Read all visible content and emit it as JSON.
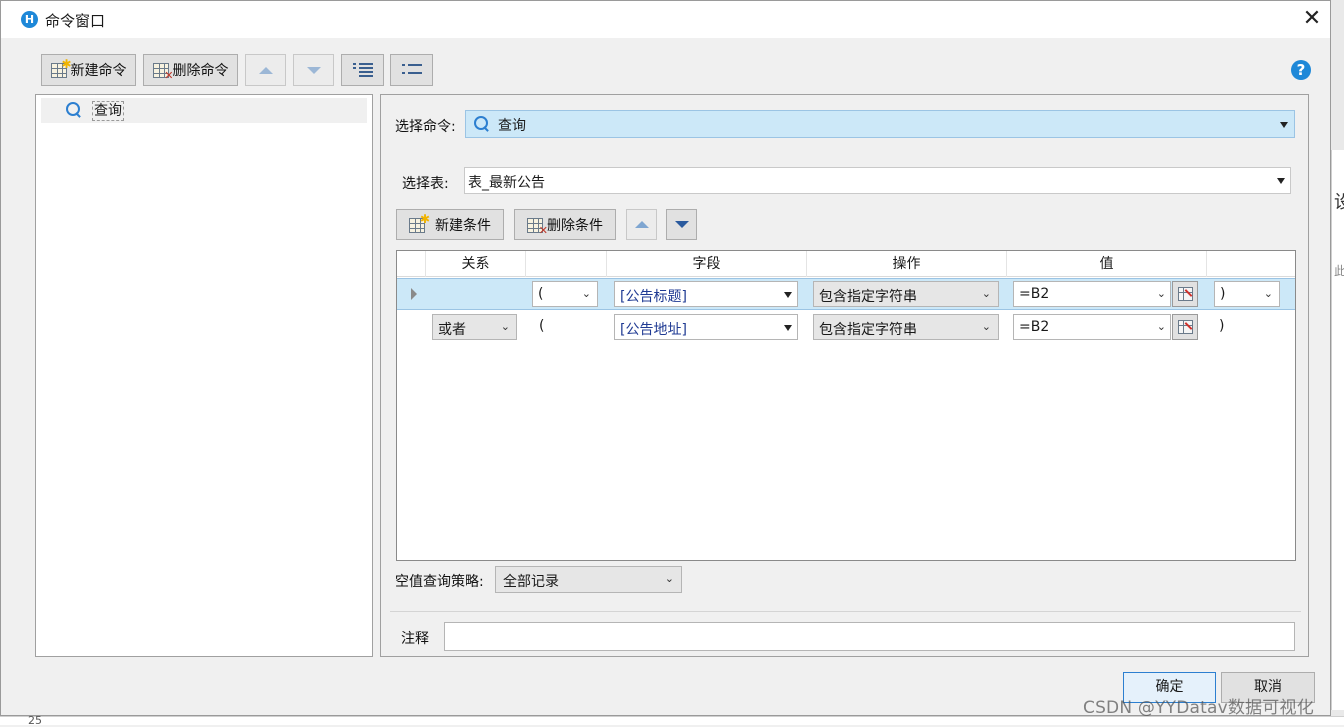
{
  "window": {
    "title": "命令窗口",
    "app_icon_glyph": "H"
  },
  "toolbar": {
    "new_command": "新建命令",
    "delete_command": "删除命令"
  },
  "tree": {
    "items": [
      {
        "label": "查询",
        "icon": "search-icon"
      }
    ]
  },
  "command": {
    "label": "选择命令:",
    "selected": "查询"
  },
  "table": {
    "label": "选择表:",
    "selected": "表_最新公告"
  },
  "conditions_toolbar": {
    "new_condition": "新建条件",
    "delete_condition": "删除条件"
  },
  "grid": {
    "columns": [
      "关系",
      "",
      "字段",
      "操作",
      "值",
      ""
    ],
    "rows": [
      {
        "relation": "",
        "open_paren": "(",
        "field": "[公告标题]",
        "operation": "包含指定字符串",
        "value": "=B2",
        "close_paren": ")"
      },
      {
        "relation": "或者",
        "open_paren": "(",
        "field": "[公告地址]",
        "operation": "包含指定字符串",
        "value": "=B2",
        "close_paren": ")"
      }
    ]
  },
  "null_strategy": {
    "label": "空值查询策略:",
    "selected": "全部记录"
  },
  "note": {
    "label": "注释",
    "value": ""
  },
  "buttons": {
    "ok": "确定",
    "cancel": "取消"
  },
  "background": {
    "right_text_1": "设",
    "right_text_2": "此",
    "row_number": "25"
  },
  "watermark": "CSDN @YYDatav数据可视化",
  "colors": {
    "selection": "#cce8f8",
    "accent": "#1e88d8",
    "field_text": "#1f3a93"
  }
}
